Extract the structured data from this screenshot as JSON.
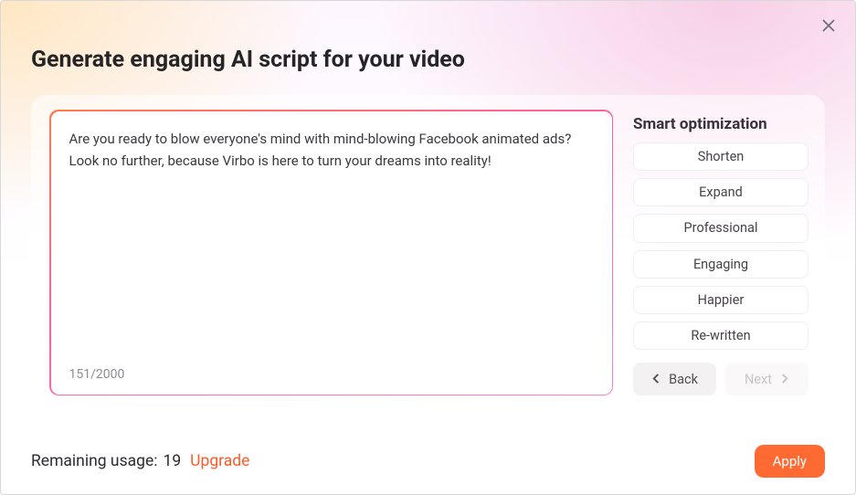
{
  "window": {
    "top_garbage": " "
  },
  "heading": "Generate engaging AI script for your video",
  "close_label": "Close",
  "script": {
    "text": "Are you ready to blow everyone's mind with mind-blowing Facebook animated ads? Look no further, because Virbo is here to turn your dreams into reality!",
    "char_count": "151/2000"
  },
  "optimization": {
    "title": "Smart optimization",
    "buttons": {
      "shorten": "Shorten",
      "expand": "Expand",
      "professional": "Professional",
      "engaging": "Engaging",
      "happier": "Happier",
      "rewritten": "Re-written"
    },
    "nav": {
      "back": "Back",
      "next": "Next"
    }
  },
  "footer": {
    "remaining_label": "Remaining usage:",
    "remaining_value": "19",
    "upgrade": "Upgrade",
    "apply": "Apply"
  },
  "colors": {
    "accent": "#ff6a33"
  }
}
